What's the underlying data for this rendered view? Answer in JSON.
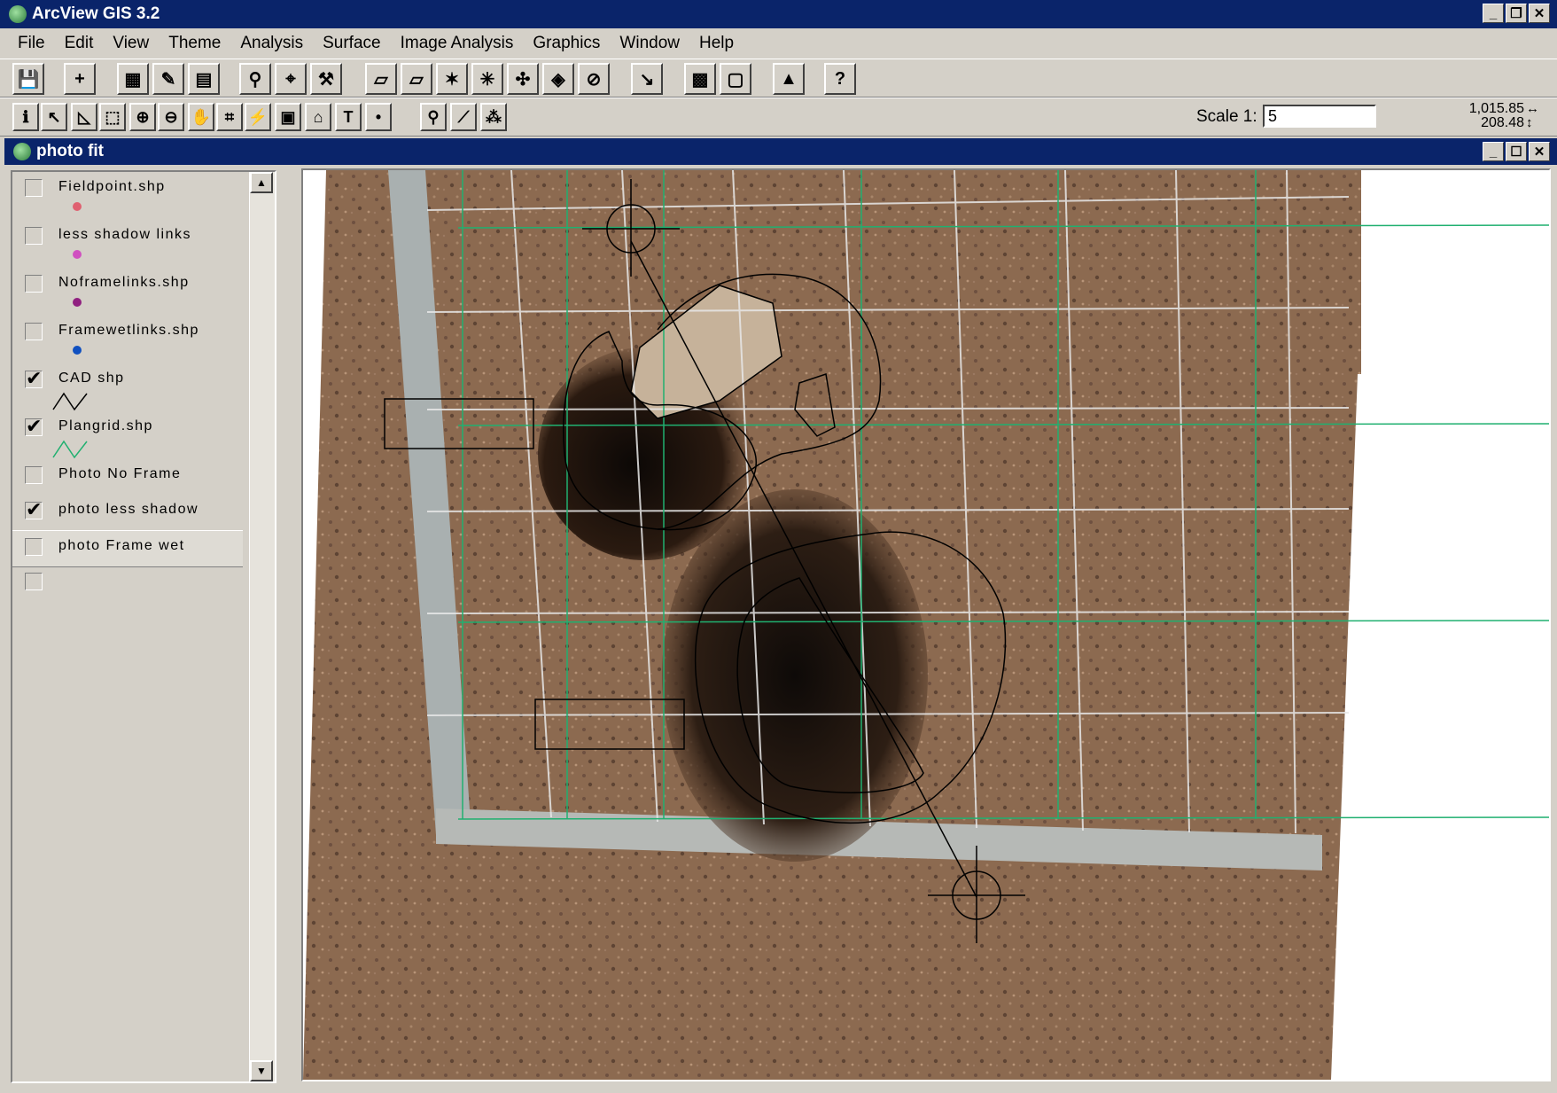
{
  "app": {
    "title": "ArcView GIS 3.2"
  },
  "menu": [
    "File",
    "Edit",
    "View",
    "Theme",
    "Analysis",
    "Surface",
    "Image Analysis",
    "Graphics",
    "Window",
    "Help"
  ],
  "toolbar2": {
    "scale_label": "Scale 1:",
    "scale_value": "5",
    "coord_x": "1,015.85",
    "coord_y": "208.48"
  },
  "view": {
    "title": "photo fit"
  },
  "legend": [
    {
      "label": "Fieldpoint.shp",
      "checked": false,
      "symbol": "point",
      "color": "#e06070"
    },
    {
      "label": "less shadow links",
      "checked": false,
      "symbol": "point",
      "color": "#d050c0"
    },
    {
      "label": "Noframelinks.shp",
      "checked": false,
      "symbol": "point",
      "color": "#902080"
    },
    {
      "label": "Framewetlinks.shp",
      "checked": false,
      "symbol": "point",
      "color": "#1050c0"
    },
    {
      "label": "CAD shp",
      "checked": true,
      "symbol": "line",
      "color": "#000000"
    },
    {
      "label": "Plangrid.shp",
      "checked": true,
      "symbol": "line",
      "color": "#20b070"
    },
    {
      "label": "Photo No Frame",
      "checked": false,
      "symbol": "none"
    },
    {
      "label": "photo less shadow",
      "checked": true,
      "symbol": "none"
    },
    {
      "label": "photo Frame wet",
      "checked": false,
      "symbol": "none"
    },
    {
      "label": "",
      "checked": false,
      "symbol": "none"
    }
  ],
  "colors": {
    "titlebar": "#0a246a",
    "face": "#d4d0c8",
    "grid_green": "#20b070",
    "soil": "#8a6548"
  }
}
